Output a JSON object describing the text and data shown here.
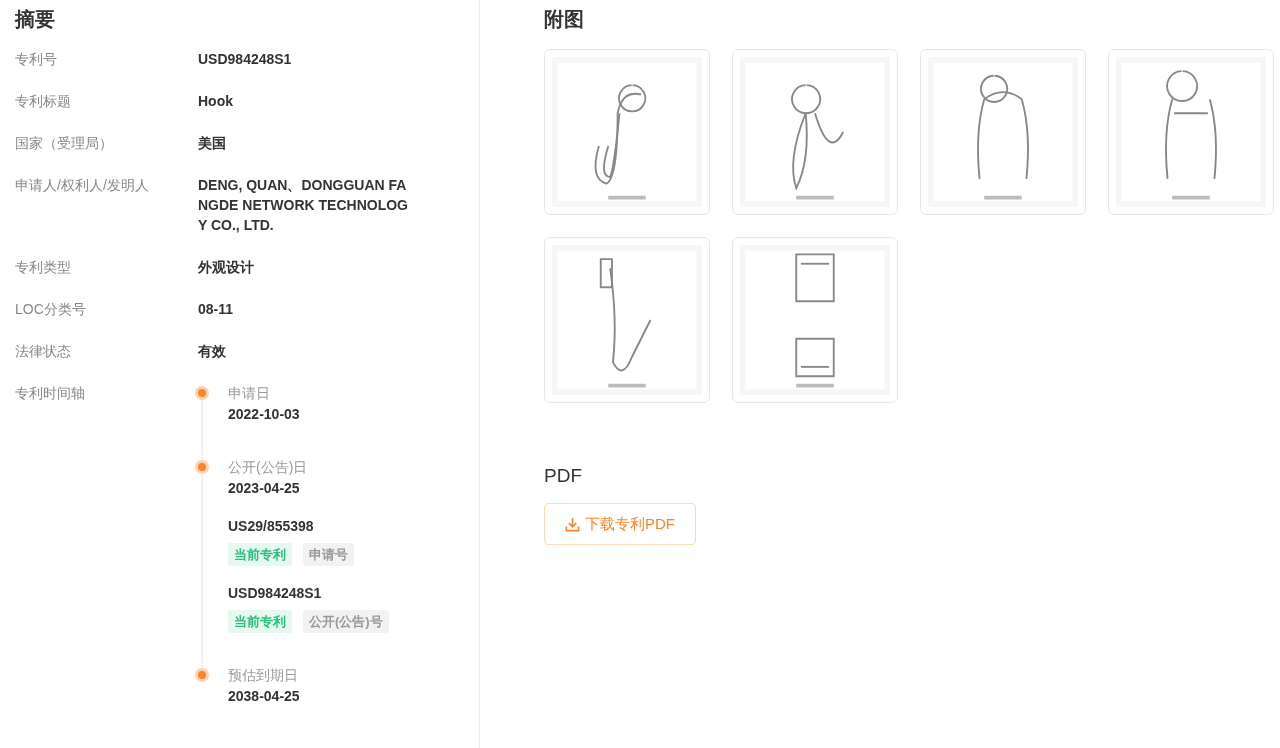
{
  "summary": {
    "title": "摘要",
    "fields": [
      {
        "label": "专利号",
        "value": "USD984248S1"
      },
      {
        "label": "专利标题",
        "value": "Hook"
      },
      {
        "label": "国家（受理局）",
        "value": "美国"
      },
      {
        "label": "申请人/权利人/发明人",
        "value": "DENG, QUAN、DONGGUAN FANGDE NETWORK TECHNOLOGY CO., LTD."
      },
      {
        "label": "专利类型",
        "value": "外观设计"
      },
      {
        "label": "LOC分类号",
        "value": "08-11"
      },
      {
        "label": "法律状态",
        "value": "有效"
      }
    ],
    "timeline": {
      "label": "专利时间轴",
      "events": [
        {
          "label": "申请日",
          "date": "2022-10-03"
        },
        {
          "label": "公开(公告)日",
          "date": "2023-04-25",
          "numbers": [
            {
              "number": "US29/855398",
              "tags": [
                {
                  "kind": "current",
                  "text": "当前专利"
                },
                {
                  "kind": "type",
                  "text": "申请号"
                }
              ]
            },
            {
              "number": "USD984248S1",
              "tags": [
                {
                  "kind": "current",
                  "text": "当前专利"
                },
                {
                  "kind": "type",
                  "text": "公开(公告)号"
                }
              ]
            }
          ]
        },
        {
          "label": "预估到期日",
          "date": "2038-04-25"
        }
      ]
    }
  },
  "figures": {
    "title": "附图"
  },
  "pdf": {
    "title": "PDF",
    "button": "下载专利PDF"
  }
}
